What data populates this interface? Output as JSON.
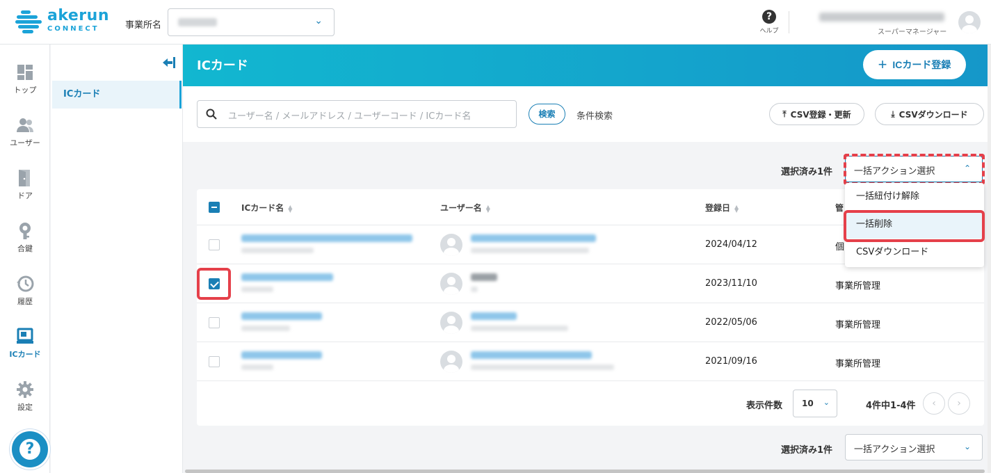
{
  "header": {
    "logo_word": "akerun",
    "logo_sub": "CONNECT",
    "office_label": "事業所名",
    "help_label": "ヘルプ",
    "user_role": "スーパーマネージャー"
  },
  "rail": {
    "items": [
      {
        "label": "トップ",
        "icon": "dashboard-icon"
      },
      {
        "label": "ユーザー",
        "icon": "users-icon"
      },
      {
        "label": "ドア",
        "icon": "door-icon"
      },
      {
        "label": "合鍵",
        "icon": "key-icon"
      },
      {
        "label": "履歴",
        "icon": "history-icon"
      },
      {
        "label": "ICカード",
        "icon": "ic-card-icon",
        "active": true
      },
      {
        "label": "設定",
        "icon": "gear-icon"
      }
    ],
    "help_glyph": "?"
  },
  "subnav": {
    "items": [
      {
        "label": "ICカード",
        "active": true
      }
    ]
  },
  "page": {
    "title": "ICカード",
    "add_button": "ICカード登録"
  },
  "search": {
    "placeholder": "ユーザー名 / メールアドレス / ユーザーコード / ICカード名",
    "button": "検索",
    "advanced": "条件検索",
    "csv_import": "CSV登録・更新",
    "csv_download": "CSVダウンロード"
  },
  "bulk": {
    "selected_count": "選択済み1件",
    "select_label": "一括アクション選択",
    "options": [
      "一括紐付け解除",
      "一括削除",
      "CSVダウンロード"
    ],
    "hovered_option": "一括削除"
  },
  "table": {
    "columns": [
      "ICカード名",
      "ユーザー名",
      "登録日",
      "管"
    ],
    "rows": [
      {
        "date": "2024/04/12",
        "mgmt": "個",
        "checked": false
      },
      {
        "date": "2023/11/10",
        "mgmt": "事業所管理",
        "checked": true
      },
      {
        "date": "2022/05/06",
        "mgmt": "事業所管理",
        "checked": false
      },
      {
        "date": "2021/09/16",
        "mgmt": "事業所管理",
        "checked": false
      }
    ]
  },
  "pagination": {
    "per_page_label": "表示件数",
    "per_page_value": "10",
    "range": "4件中1-4件"
  },
  "colors": {
    "accent": "#1a7fb5",
    "band_start": "#12b7d0",
    "band_end": "#1597c9",
    "highlight": "#e5404a"
  }
}
